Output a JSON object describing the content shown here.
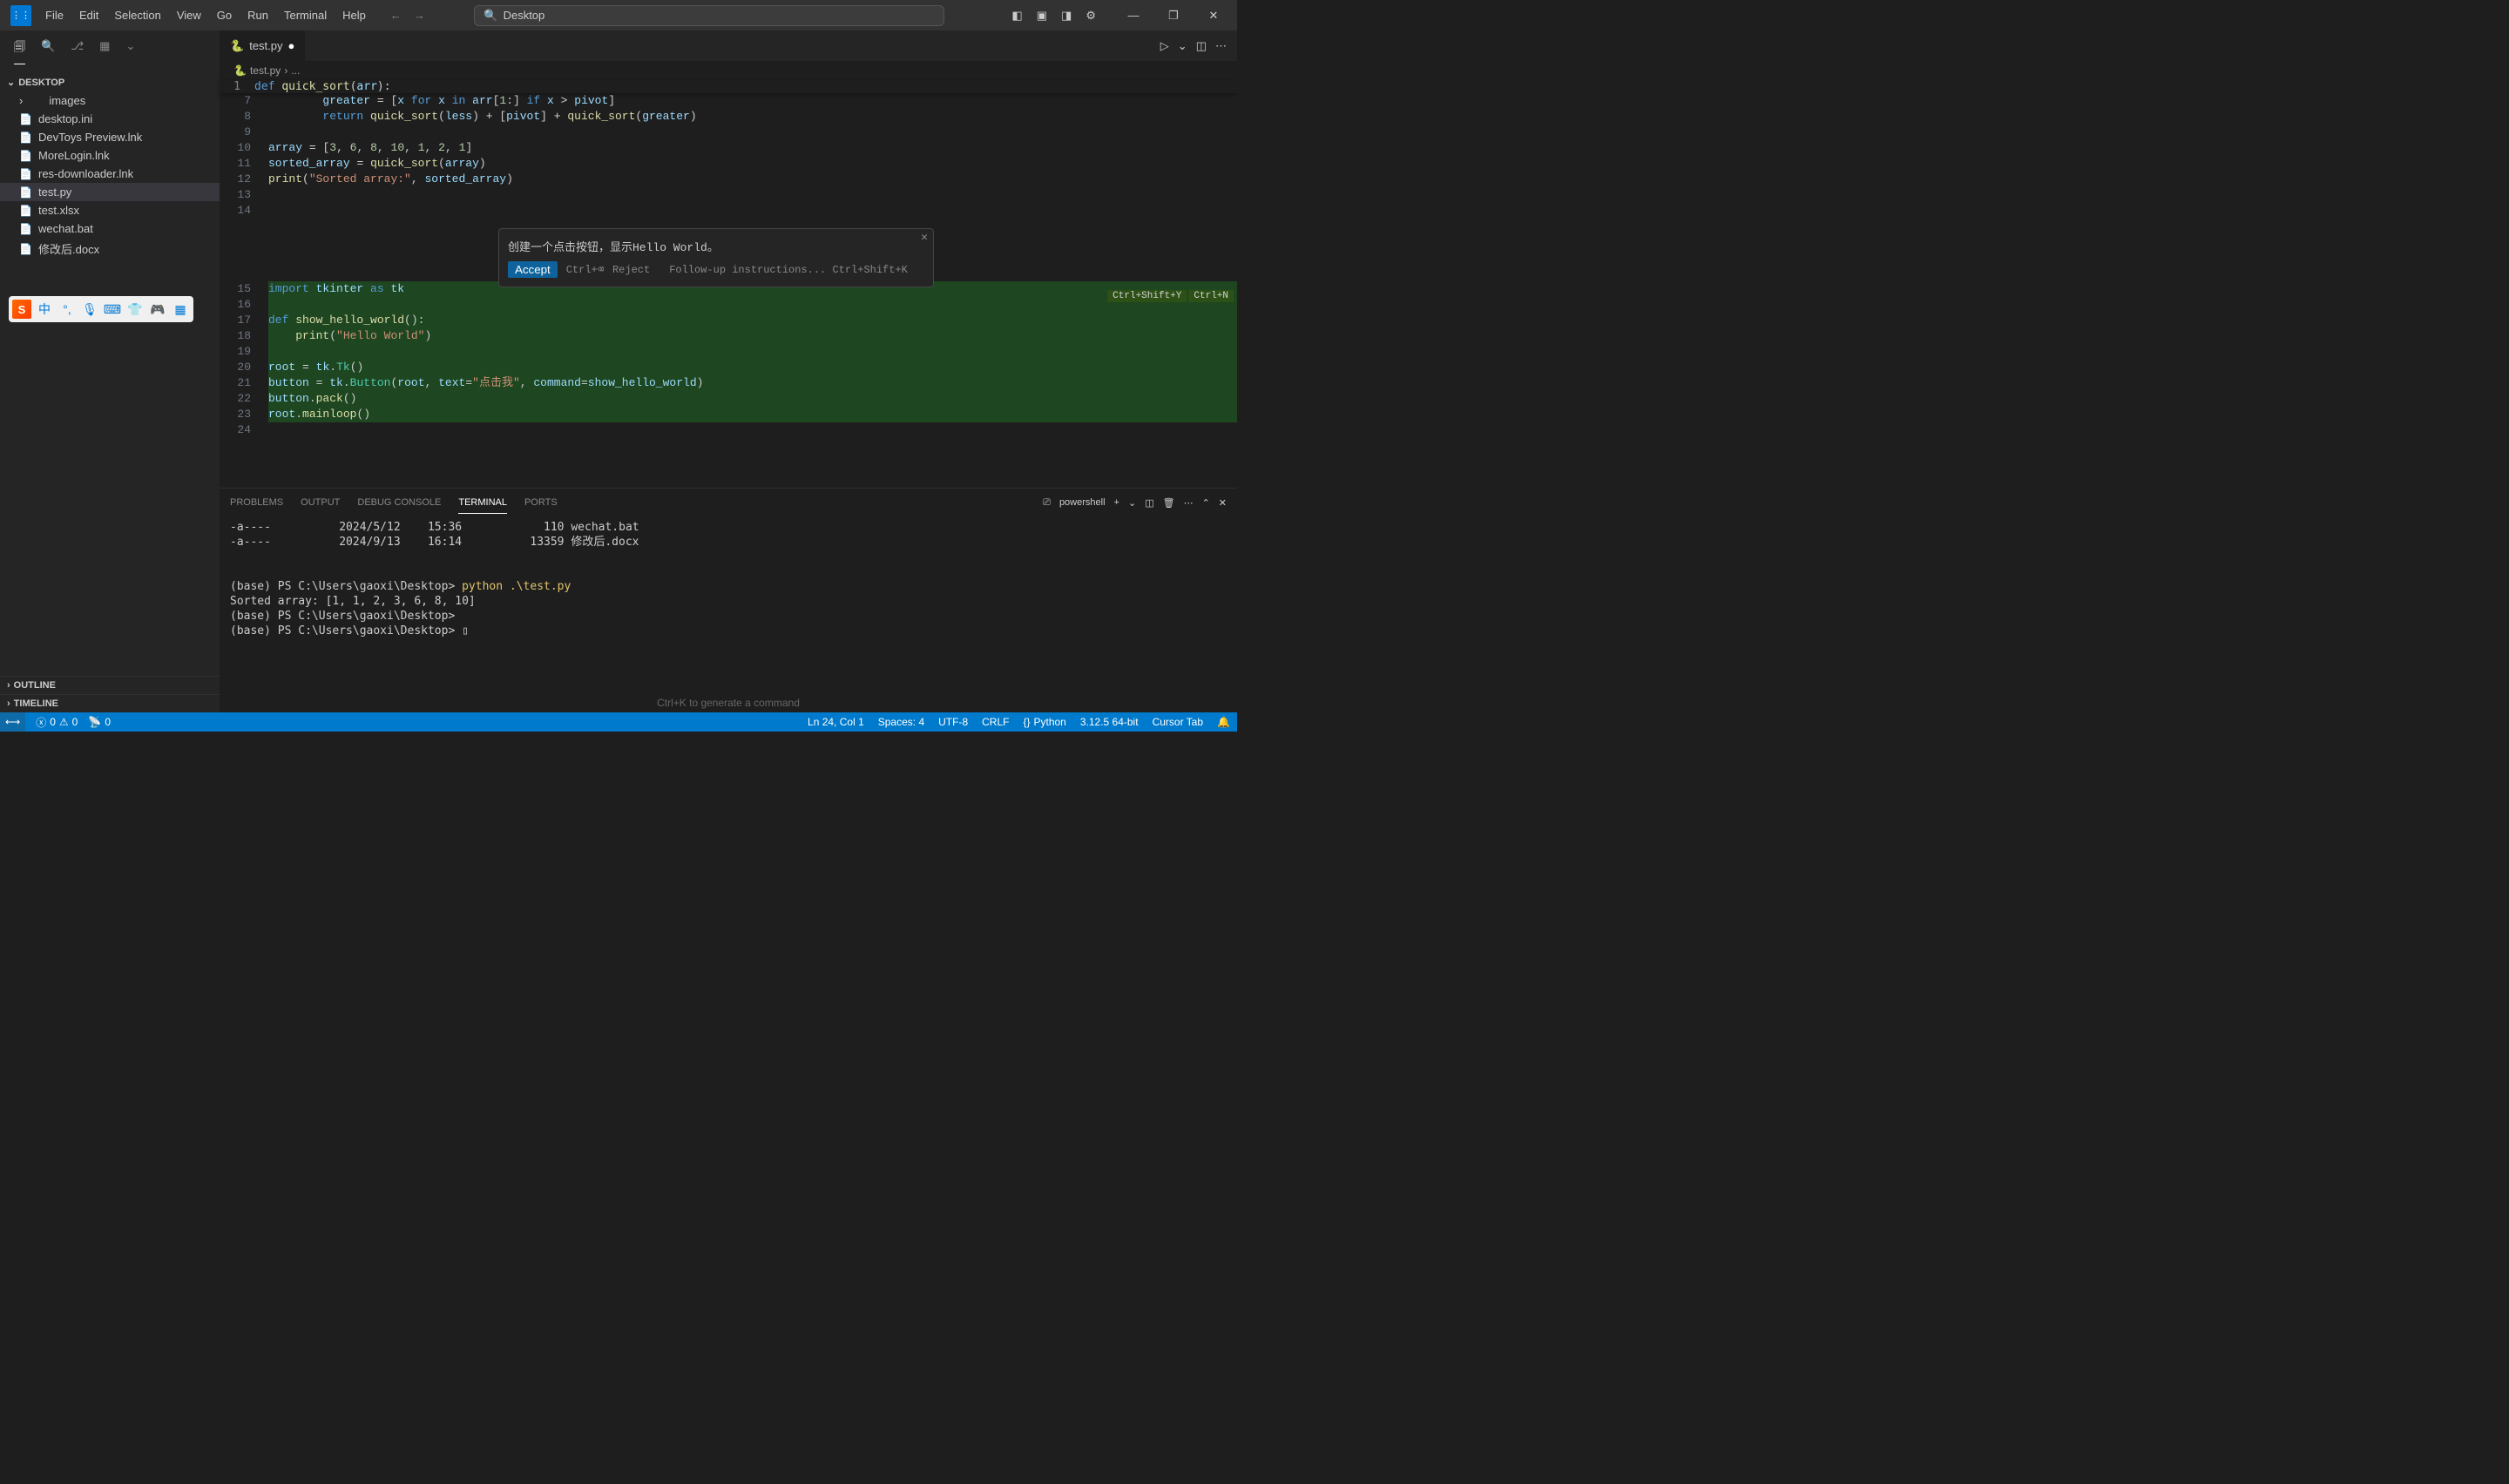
{
  "menu": {
    "file": "File",
    "edit": "Edit",
    "selection": "Selection",
    "view": "View",
    "go": "Go",
    "run": "Run",
    "terminal": "Terminal",
    "help": "Help"
  },
  "search_placeholder": "Desktop",
  "explorer": {
    "title": "DESKTOP",
    "items": [
      {
        "name": "images",
        "type": "folder"
      },
      {
        "name": "desktop.ini",
        "type": "file"
      },
      {
        "name": "DevToys Preview.lnk",
        "type": "file"
      },
      {
        "name": "MoreLogin.lnk",
        "type": "file"
      },
      {
        "name": "res-downloader.lnk",
        "type": "file"
      },
      {
        "name": "test.py",
        "type": "file",
        "selected": true
      },
      {
        "name": "test.xlsx",
        "type": "file"
      },
      {
        "name": "wechat.bat",
        "type": "file"
      },
      {
        "name": "修改后.docx",
        "type": "file"
      }
    ],
    "outline": "OUTLINE",
    "timeline": "TIMELINE"
  },
  "ime": {
    "logo": "S",
    "lang": "中"
  },
  "tab": {
    "filename": "test.py"
  },
  "breadcrumb": {
    "file": "test.py",
    "sep": "›",
    "more": "..."
  },
  "sticky": {
    "ln": "1",
    "content_html": "<span class='py-def'>def</span> <span class='fn'>quick_sort</span>(<span class='var'>arr</span>):"
  },
  "code_lines": [
    {
      "n": "7",
      "html": "        <span class='var'>greater</span> <span class='op'>=</span> [<span class='var'>x</span> <span class='kw'>for</span> <span class='var'>x</span> <span class='kw'>in</span> <span class='var'>arr</span>[<span class='num'>1</span>:] <span class='kw'>if</span> <span class='var'>x</span> <span class='op'>&gt;</span> <span class='var'>pivot</span>]"
    },
    {
      "n": "8",
      "html": "        <span class='kw'>return</span> <span class='fn'>quick_sort</span>(<span class='var'>less</span>) <span class='op'>+</span> [<span class='var'>pivot</span>] <span class='op'>+</span> <span class='fn'>quick_sort</span>(<span class='var'>greater</span>)"
    },
    {
      "n": "9",
      "html": ""
    },
    {
      "n": "10",
      "html": "<span class='var'>array</span> <span class='op'>=</span> [<span class='num'>3</span>, <span class='num'>6</span>, <span class='num'>8</span>, <span class='num'>10</span>, <span class='num'>1</span>, <span class='num'>2</span>, <span class='num'>1</span>]"
    },
    {
      "n": "11",
      "html": "<span class='var'>sorted_array</span> <span class='op'>=</span> <span class='fn'>quick_sort</span>(<span class='var'>array</span>)"
    },
    {
      "n": "12",
      "html": "<span class='fn'>print</span>(<span class='str'>\"Sorted array:\"</span>, <span class='var'>sorted_array</span>)"
    },
    {
      "n": "13",
      "html": ""
    },
    {
      "n": "14",
      "html": ""
    },
    {
      "n": "",
      "html": "",
      "spacer": true
    },
    {
      "n": "",
      "html": "",
      "spacer": true
    },
    {
      "n": "",
      "html": "",
      "spacer": true
    },
    {
      "n": "",
      "html": "",
      "spacer": true
    },
    {
      "n": "15",
      "html": "<span class='kw'>import</span> <span class='var'>tkinter</span> <span class='kw'>as</span> <span class='var'>tk</span>",
      "hl": true
    },
    {
      "n": "16",
      "html": "",
      "hl": true
    },
    {
      "n": "17",
      "html": "<span class='py-def'>def</span> <span class='fn'>show_hello_world</span>():",
      "hl": true
    },
    {
      "n": "18",
      "html": "    <span class='fn'>print</span>(<span class='str'>\"Hello World\"</span>)",
      "hl": true
    },
    {
      "n": "19",
      "html": "",
      "hl": true
    },
    {
      "n": "20",
      "html": "<span class='var'>root</span> <span class='op'>=</span> <span class='var'>tk</span>.<span class='cls'>Tk</span>()",
      "hl": true
    },
    {
      "n": "21",
      "html": "<span class='var'>button</span> <span class='op'>=</span> <span class='var'>tk</span>.<span class='cls'>Button</span>(<span class='var'>root</span>, <span class='var'>text</span><span class='op'>=</span><span class='str'>\"点击我\"</span>, <span class='var'>command</span><span class='op'>=</span><span class='var'>show_hello_world</span>)",
      "hl": true
    },
    {
      "n": "22",
      "html": "<span class='var'>button</span>.<span class='fn'>pack</span>()",
      "hl": true
    },
    {
      "n": "23",
      "html": "<span class='var'>root</span>.<span class='fn'>mainloop</span>()",
      "hl": true
    },
    {
      "n": "24",
      "html": ""
    }
  ],
  "ai": {
    "prompt": "创建一个点击按钮，显示Hello World。",
    "accept": "Accept",
    "reject_shortcut": "Ctrl+⌫",
    "reject": "Reject",
    "followup": "Follow-up instructions...",
    "followup_shortcut": "Ctrl+Shift+K"
  },
  "badges": {
    "b1": "Ctrl+Shift+Y",
    "b2": "Ctrl+N"
  },
  "term_tabs": {
    "problems": "PROBLEMS",
    "output": "OUTPUT",
    "debug": "DEBUG CONSOLE",
    "terminal": "TERMINAL",
    "ports": "PORTS"
  },
  "term_profile": "powershell",
  "terminal_lines": [
    "-a----          2024/5/12    15:36            110 wechat.bat",
    "-a----          2024/9/13    16:14          13359 修改后.docx",
    "",
    "",
    "(base) PS C:\\Users\\gaoxi\\Desktop> python .\\test.py",
    "Sorted array: [1, 1, 2, 3, 6, 8, 10]",
    "(base) PS C:\\Users\\gaoxi\\Desktop>",
    "(base) PS C:\\Users\\gaoxi\\Desktop> ▯"
  ],
  "term_hint": "Ctrl+K to generate a command",
  "status": {
    "errors": "0",
    "warnings": "0",
    "ports": "0",
    "pos": "Ln 24, Col 1",
    "spaces": "Spaces: 4",
    "encoding": "UTF-8",
    "eol": "CRLF",
    "lang": "Python",
    "interp": "3.12.5 64-bit",
    "cursor": "Cursor Tab"
  }
}
